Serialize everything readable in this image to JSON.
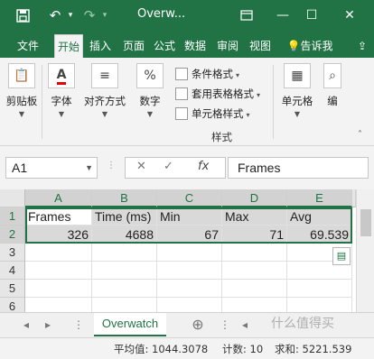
{
  "titlebar": {
    "title": "Overw...",
    "save_icon": "save-icon",
    "min_icon": "—",
    "max_icon": "☐",
    "close_icon": "✕",
    "accent": "#217346"
  },
  "tabs": [
    "文件",
    "开始",
    "插入",
    "页面",
    "公式",
    "数据",
    "审阅",
    "视图",
    "告诉我"
  ],
  "ribbon": {
    "clipboard": "剪贴板",
    "font": "字体",
    "alignment": "对齐方式",
    "number": "数字",
    "cond_format": "条件格式",
    "table_format": "套用表格格式",
    "cell_style": "单元格样式",
    "styles_group": "样式",
    "cells": "单元格",
    "edit": "编"
  },
  "formula_bar": {
    "name_box": "A1",
    "fx": "fx",
    "content": "Frames"
  },
  "grid": {
    "columns": [
      "A",
      "B",
      "C",
      "D",
      "E"
    ],
    "rows": [
      "1",
      "2",
      "3",
      "4",
      "5",
      "6"
    ],
    "row1": [
      "Frames",
      "Time (ms)",
      "Min",
      "Max",
      "Avg"
    ],
    "row2": [
      "326",
      "4688",
      "67",
      "71",
      "69.539"
    ]
  },
  "sheet": {
    "active_tab": "Overwatch",
    "add": "⊕"
  },
  "status": {
    "average": "平均值: 1044.3078",
    "count": "计数: 10",
    "sum": "求和: 5221.539"
  },
  "watermark": "什么值得买"
}
